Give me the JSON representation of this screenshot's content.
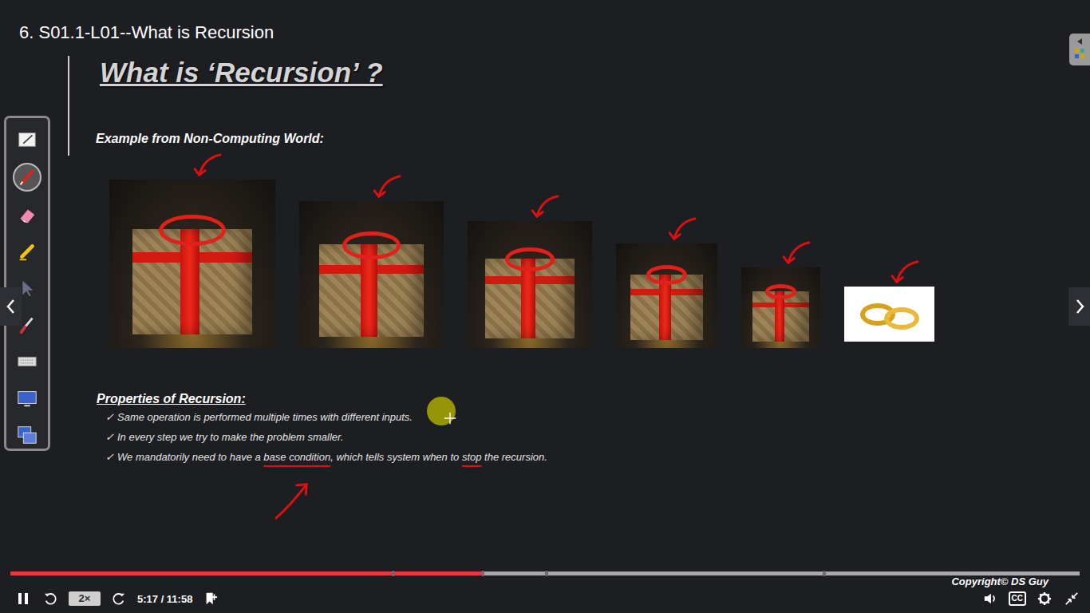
{
  "lecture": {
    "title": "6. S01.1-L01--What is Recursion"
  },
  "slide": {
    "heading": "What is ‘Recursion’ ?",
    "subheading": "Example from Non-Computing World:",
    "pictures": [
      {
        "kind": "gift",
        "annotated": true
      },
      {
        "kind": "gift",
        "annotated": true
      },
      {
        "kind": "gift",
        "annotated": true
      },
      {
        "kind": "gift",
        "annotated": true
      },
      {
        "kind": "gift",
        "annotated": true
      },
      {
        "kind": "rings",
        "annotated": true
      }
    ],
    "properties": {
      "heading": "Properties of Recursion:",
      "items": [
        {
          "check": "✓",
          "segments": [
            {
              "text": "Same operation is performed multiple times with different inputs.",
              "marked": false
            }
          ]
        },
        {
          "check": "✓",
          "segments": [
            {
              "text": "In every step we try to make the problem smaller.",
              "marked": false
            }
          ]
        },
        {
          "check": "✓",
          "segments": [
            {
              "text": "We mandatorily need to have a ",
              "marked": false
            },
            {
              "text": "base condition",
              "marked": true
            },
            {
              "text": ", which tells system when to ",
              "marked": false
            },
            {
              "text": "stop",
              "marked": true
            },
            {
              "text": " the recursion.",
              "marked": false
            }
          ]
        }
      ]
    },
    "base_arrow": true
  },
  "annotation_tools": [
    {
      "kind": "whiteboard",
      "selected": false
    },
    {
      "kind": "pen",
      "selected": true
    },
    {
      "kind": "eraser",
      "selected": false
    },
    {
      "kind": "highlighter",
      "selected": false
    },
    {
      "kind": "pointer",
      "selected": false
    },
    {
      "kind": "brush",
      "selected": false
    },
    {
      "kind": "keyboard",
      "selected": false
    },
    {
      "kind": "screen",
      "selected": false
    },
    {
      "kind": "capture",
      "selected": false
    }
  ],
  "player": {
    "playing": true,
    "progress": {
      "level": 0.441,
      "chapters": [
        0.357,
        0.44,
        0.5,
        0.76
      ]
    },
    "speed": "2×",
    "time": "5:17 / 11:58",
    "captions": "CC",
    "copyright": "Copyright© DS Guy"
  }
}
